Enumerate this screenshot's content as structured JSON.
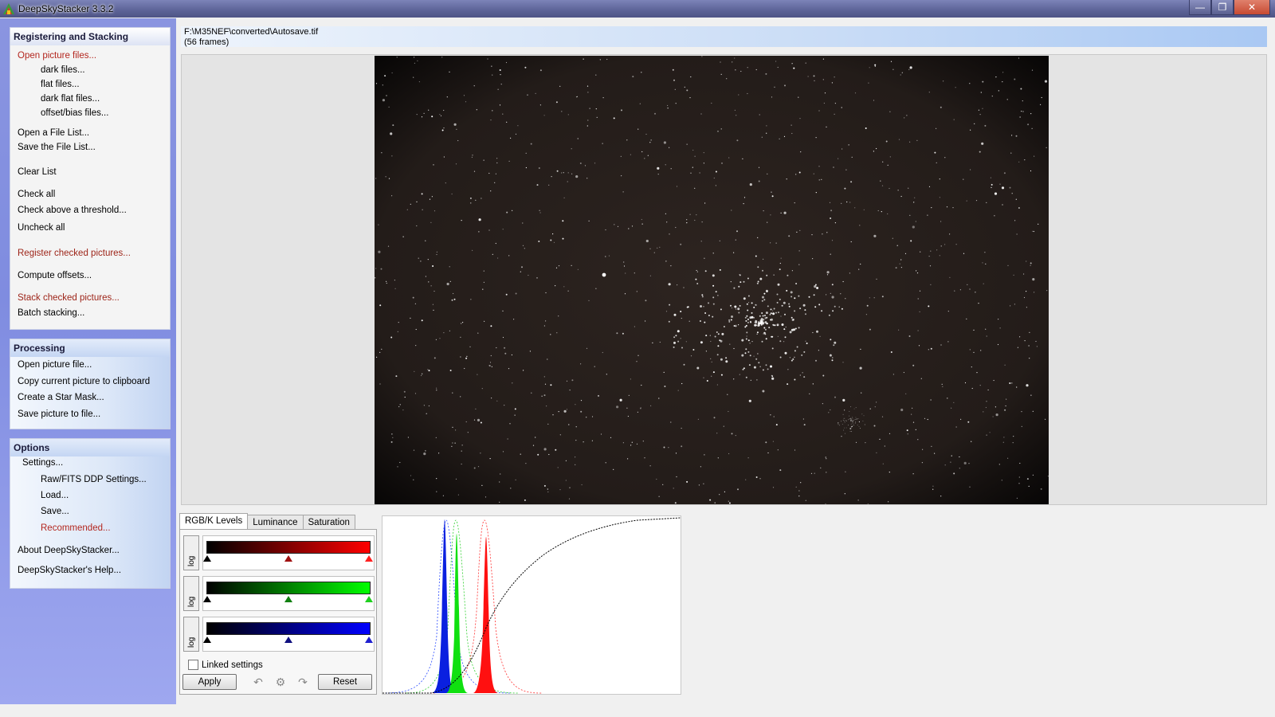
{
  "window": {
    "title": "DeepSkyStacker 3.3.2",
    "min": "—",
    "max": "❐",
    "close": "✕"
  },
  "registering": {
    "title": "Registering and Stacking",
    "open_picture_files": "Open picture files...",
    "dark_files": "dark files...",
    "flat_files": "flat files...",
    "dark_flat_files": "dark flat files...",
    "offset_bias_files": "offset/bias files...",
    "open_file_list": "Open a File List...",
    "save_file_list": "Save the File List...",
    "clear_list": "Clear List",
    "check_all": "Check all",
    "check_above_threshold": "Check above a threshold...",
    "uncheck_all": "Uncheck all",
    "register_checked": "Register checked pictures...",
    "compute_offsets": "Compute offsets...",
    "stack_checked": "Stack checked pictures...",
    "batch_stacking": "Batch stacking..."
  },
  "processing": {
    "title": "Processing",
    "open_picture_file": "Open picture file...",
    "copy_to_clipboard": "Copy current picture to clipboard",
    "create_star_mask": "Create a Star Mask...",
    "save_picture": "Save picture to file..."
  },
  "options": {
    "title": "Options",
    "settings": "Settings...",
    "raw_fits": "Raw/FITS DDP Settings...",
    "load": "Load...",
    "save": "Save...",
    "recommended": "Recommended...",
    "about": "About DeepSkyStacker...",
    "help": "DeepSkyStacker's Help..."
  },
  "file": {
    "path": "F:\\M35NEF\\converted\\Autosave.tif",
    "frames": "(56 frames)"
  },
  "tabs": {
    "rgbk": "RGB/K Levels",
    "luminance": "Luminance",
    "saturation": "Saturation"
  },
  "levels": {
    "log_label": "log",
    "linked_label": "Linked settings",
    "apply_label": "Apply",
    "reset_label": "Reset",
    "channels": [
      {
        "color": "#ff0000",
        "black": 0.0,
        "mid": 0.5,
        "white": 1.0
      },
      {
        "color": "#00ff00",
        "black": 0.0,
        "mid": 0.5,
        "white": 1.0
      },
      {
        "color": "#0000ff",
        "black": 0.0,
        "mid": 0.5,
        "white": 1.0
      }
    ]
  },
  "icons": {
    "app": "dss-app-icon",
    "undo": "undo-icon",
    "settings": "gear-icon",
    "redo": "redo-icon"
  }
}
